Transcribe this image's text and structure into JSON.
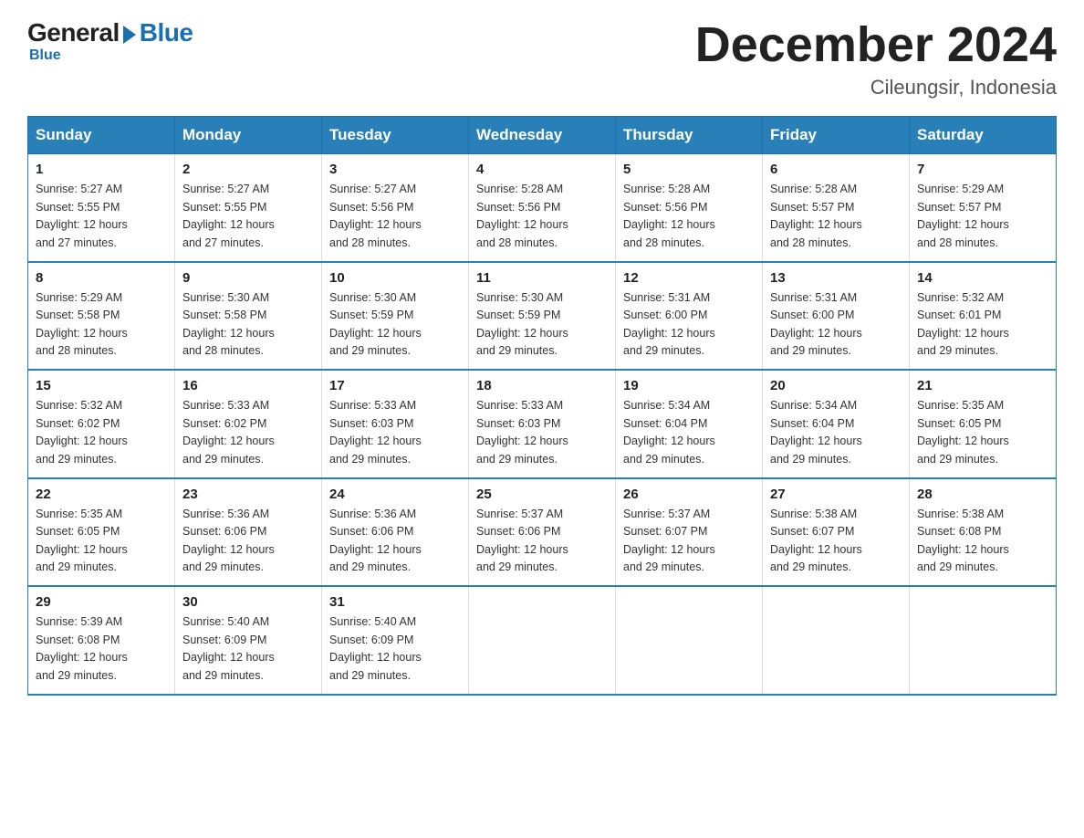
{
  "logo": {
    "general": "General",
    "blue": "Blue"
  },
  "title": {
    "month_year": "December 2024",
    "location": "Cileungsir, Indonesia"
  },
  "headers": [
    "Sunday",
    "Monday",
    "Tuesday",
    "Wednesday",
    "Thursday",
    "Friday",
    "Saturday"
  ],
  "weeks": [
    [
      {
        "day": "1",
        "info": "Sunrise: 5:27 AM\nSunset: 5:55 PM\nDaylight: 12 hours\nand 27 minutes."
      },
      {
        "day": "2",
        "info": "Sunrise: 5:27 AM\nSunset: 5:55 PM\nDaylight: 12 hours\nand 27 minutes."
      },
      {
        "day": "3",
        "info": "Sunrise: 5:27 AM\nSunset: 5:56 PM\nDaylight: 12 hours\nand 28 minutes."
      },
      {
        "day": "4",
        "info": "Sunrise: 5:28 AM\nSunset: 5:56 PM\nDaylight: 12 hours\nand 28 minutes."
      },
      {
        "day": "5",
        "info": "Sunrise: 5:28 AM\nSunset: 5:56 PM\nDaylight: 12 hours\nand 28 minutes."
      },
      {
        "day": "6",
        "info": "Sunrise: 5:28 AM\nSunset: 5:57 PM\nDaylight: 12 hours\nand 28 minutes."
      },
      {
        "day": "7",
        "info": "Sunrise: 5:29 AM\nSunset: 5:57 PM\nDaylight: 12 hours\nand 28 minutes."
      }
    ],
    [
      {
        "day": "8",
        "info": "Sunrise: 5:29 AM\nSunset: 5:58 PM\nDaylight: 12 hours\nand 28 minutes."
      },
      {
        "day": "9",
        "info": "Sunrise: 5:30 AM\nSunset: 5:58 PM\nDaylight: 12 hours\nand 28 minutes."
      },
      {
        "day": "10",
        "info": "Sunrise: 5:30 AM\nSunset: 5:59 PM\nDaylight: 12 hours\nand 29 minutes."
      },
      {
        "day": "11",
        "info": "Sunrise: 5:30 AM\nSunset: 5:59 PM\nDaylight: 12 hours\nand 29 minutes."
      },
      {
        "day": "12",
        "info": "Sunrise: 5:31 AM\nSunset: 6:00 PM\nDaylight: 12 hours\nand 29 minutes."
      },
      {
        "day": "13",
        "info": "Sunrise: 5:31 AM\nSunset: 6:00 PM\nDaylight: 12 hours\nand 29 minutes."
      },
      {
        "day": "14",
        "info": "Sunrise: 5:32 AM\nSunset: 6:01 PM\nDaylight: 12 hours\nand 29 minutes."
      }
    ],
    [
      {
        "day": "15",
        "info": "Sunrise: 5:32 AM\nSunset: 6:02 PM\nDaylight: 12 hours\nand 29 minutes."
      },
      {
        "day": "16",
        "info": "Sunrise: 5:33 AM\nSunset: 6:02 PM\nDaylight: 12 hours\nand 29 minutes."
      },
      {
        "day": "17",
        "info": "Sunrise: 5:33 AM\nSunset: 6:03 PM\nDaylight: 12 hours\nand 29 minutes."
      },
      {
        "day": "18",
        "info": "Sunrise: 5:33 AM\nSunset: 6:03 PM\nDaylight: 12 hours\nand 29 minutes."
      },
      {
        "day": "19",
        "info": "Sunrise: 5:34 AM\nSunset: 6:04 PM\nDaylight: 12 hours\nand 29 minutes."
      },
      {
        "day": "20",
        "info": "Sunrise: 5:34 AM\nSunset: 6:04 PM\nDaylight: 12 hours\nand 29 minutes."
      },
      {
        "day": "21",
        "info": "Sunrise: 5:35 AM\nSunset: 6:05 PM\nDaylight: 12 hours\nand 29 minutes."
      }
    ],
    [
      {
        "day": "22",
        "info": "Sunrise: 5:35 AM\nSunset: 6:05 PM\nDaylight: 12 hours\nand 29 minutes."
      },
      {
        "day": "23",
        "info": "Sunrise: 5:36 AM\nSunset: 6:06 PM\nDaylight: 12 hours\nand 29 minutes."
      },
      {
        "day": "24",
        "info": "Sunrise: 5:36 AM\nSunset: 6:06 PM\nDaylight: 12 hours\nand 29 minutes."
      },
      {
        "day": "25",
        "info": "Sunrise: 5:37 AM\nSunset: 6:06 PM\nDaylight: 12 hours\nand 29 minutes."
      },
      {
        "day": "26",
        "info": "Sunrise: 5:37 AM\nSunset: 6:07 PM\nDaylight: 12 hours\nand 29 minutes."
      },
      {
        "day": "27",
        "info": "Sunrise: 5:38 AM\nSunset: 6:07 PM\nDaylight: 12 hours\nand 29 minutes."
      },
      {
        "day": "28",
        "info": "Sunrise: 5:38 AM\nSunset: 6:08 PM\nDaylight: 12 hours\nand 29 minutes."
      }
    ],
    [
      {
        "day": "29",
        "info": "Sunrise: 5:39 AM\nSunset: 6:08 PM\nDaylight: 12 hours\nand 29 minutes."
      },
      {
        "day": "30",
        "info": "Sunrise: 5:40 AM\nSunset: 6:09 PM\nDaylight: 12 hours\nand 29 minutes."
      },
      {
        "day": "31",
        "info": "Sunrise: 5:40 AM\nSunset: 6:09 PM\nDaylight: 12 hours\nand 29 minutes."
      },
      {
        "day": "",
        "info": ""
      },
      {
        "day": "",
        "info": ""
      },
      {
        "day": "",
        "info": ""
      },
      {
        "day": "",
        "info": ""
      }
    ]
  ]
}
